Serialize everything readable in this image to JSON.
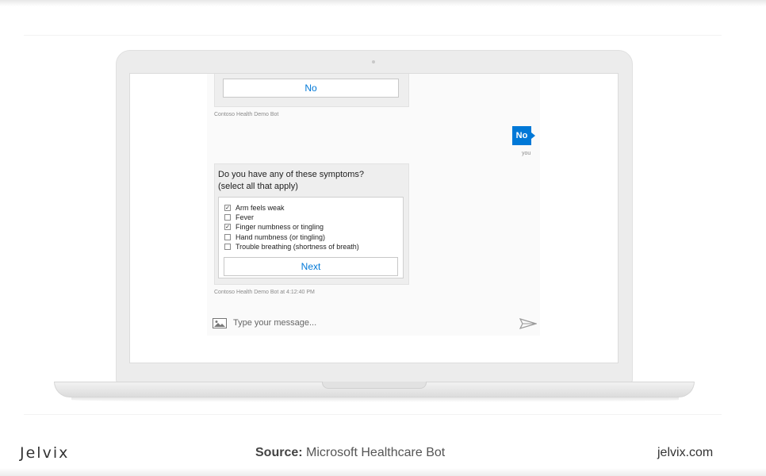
{
  "chat": {
    "previous_card_button": "No",
    "previous_card_meta": "Contoso Health Demo Bot",
    "user_message": "No",
    "user_meta": "you",
    "question_line1": "Do you have any of these symptoms?",
    "question_line2": "(select all that apply)",
    "options": [
      {
        "label": "Arm feels weak",
        "checked": true
      },
      {
        "label": "Fever",
        "checked": false
      },
      {
        "label": "Finger numbness or tingling",
        "checked": true
      },
      {
        "label": "Hand numbness (or tingling)",
        "checked": false
      },
      {
        "label": "Trouble breathing (shortness of breath)",
        "checked": false
      }
    ],
    "next_button": "Next",
    "card_meta": "Contoso Health Demo Bot at 4:12:40 PM",
    "input_placeholder": "Type your message..."
  },
  "footer": {
    "logo": "Jelvix",
    "source_label": "Source:",
    "source_text": "Microsoft Healthcare Bot",
    "site": "jelvix.com"
  },
  "colors": {
    "accent": "#0078d7",
    "card_bg": "#eeeeee"
  },
  "icons": [
    "image-icon",
    "send-icon",
    "checkbox-icon"
  ]
}
